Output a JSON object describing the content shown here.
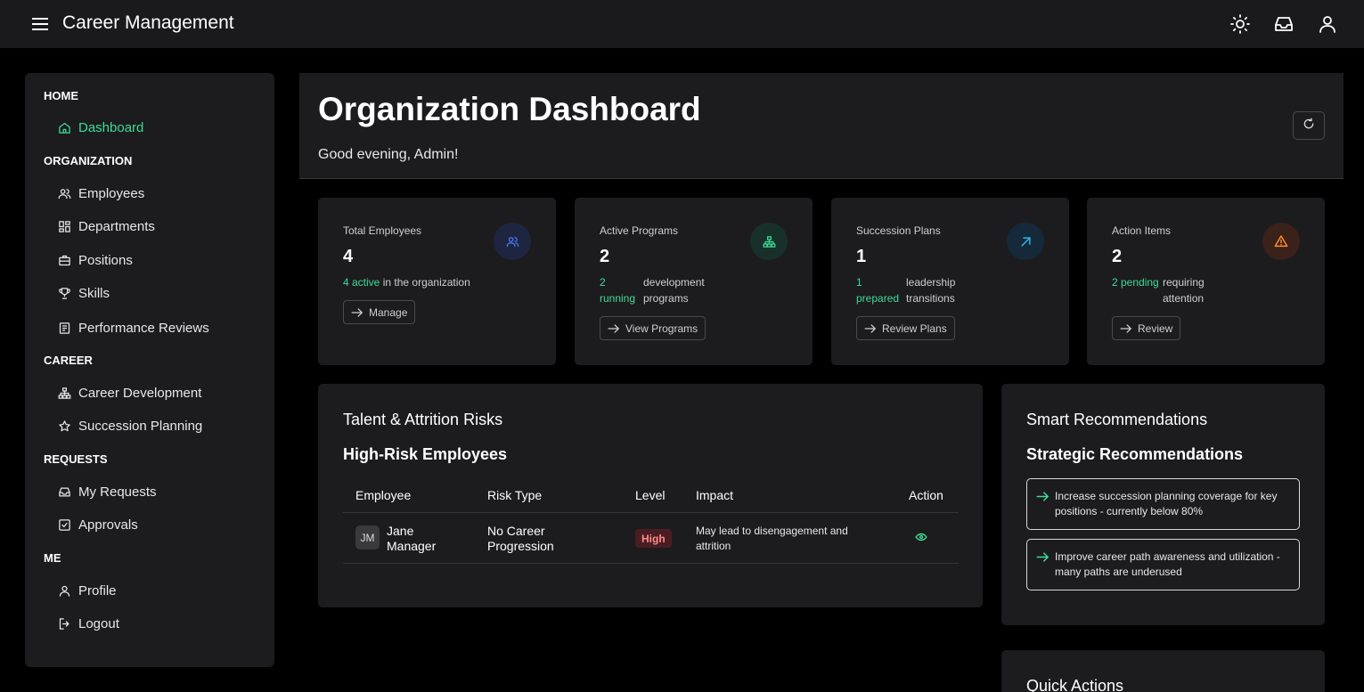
{
  "app": {
    "title": "Career Management"
  },
  "sidebar": {
    "sections": [
      {
        "label": "HOME",
        "items": [
          {
            "label": "Dashboard",
            "icon": "home-icon"
          }
        ]
      },
      {
        "label": "ORGANIZATION",
        "items": [
          {
            "label": "Employees",
            "icon": "users-icon"
          },
          {
            "label": "Departments",
            "icon": "grid-icon"
          },
          {
            "label": "Positions",
            "icon": "briefcase-icon"
          },
          {
            "label": "Skills",
            "icon": "trophy-icon"
          },
          {
            "label": "Performance Reviews",
            "icon": "document-icon"
          }
        ]
      },
      {
        "label": "CAREER",
        "items": [
          {
            "label": "Career Development",
            "icon": "hierarchy-icon"
          },
          {
            "label": "Succession Planning",
            "icon": "star-icon"
          }
        ]
      },
      {
        "label": "REQUESTS",
        "items": [
          {
            "label": "My Requests",
            "icon": "inbox-icon"
          },
          {
            "label": "Approvals",
            "icon": "checkbox-icon"
          }
        ]
      },
      {
        "label": "ME",
        "items": [
          {
            "label": "Profile",
            "icon": "person-icon"
          },
          {
            "label": "Logout",
            "icon": "logout-icon"
          }
        ]
      }
    ]
  },
  "header": {
    "title": "Organization Dashboard",
    "greeting": "Good evening, Admin!"
  },
  "stats": [
    {
      "label": "Total Employees",
      "value": "4",
      "hl": "4 active",
      "rest": "in the organization",
      "button": "Manage",
      "icon": "users-icon",
      "color": "#4a7dff"
    },
    {
      "label": "Active Programs",
      "value": "2",
      "hl": "2 running",
      "rest": "development programs",
      "button": "View Programs",
      "icon": "hierarchy-icon",
      "color": "#3ddc97"
    },
    {
      "label": "Succession Plans",
      "value": "1",
      "hl": "1 prepared",
      "rest": "leadership transitions",
      "button": "Review Plans",
      "icon": "arrow-up-right-icon",
      "color": "#2fb5e8"
    },
    {
      "label": "Action Items",
      "value": "2",
      "hl": "2 pending",
      "rest": "requiring attention",
      "button": "Review",
      "icon": "warning-icon",
      "color": "#ff8c2a"
    }
  ],
  "risks": {
    "title": "Talent & Attrition Risks",
    "subtitle": "High-Risk Employees",
    "columns": [
      "Employee",
      "Risk Type",
      "Level",
      "Impact",
      "Action"
    ],
    "rows": [
      {
        "initials": "JM",
        "name": "Jane Manager",
        "risk_type": "No Career Progression",
        "level": "High",
        "impact": "May lead to disengagement and attrition"
      }
    ]
  },
  "recommendations": {
    "title": "Smart Recommendations",
    "subtitle": "Strategic Recommendations",
    "items": [
      "Increase succession planning coverage for key positions - currently below 80%",
      "Improve career path awareness and utilization - many paths are underused"
    ]
  },
  "quick_actions": {
    "title": "Quick Actions"
  },
  "colors": {
    "accent": "#3ddc97",
    "high": "#ff8a8a"
  }
}
